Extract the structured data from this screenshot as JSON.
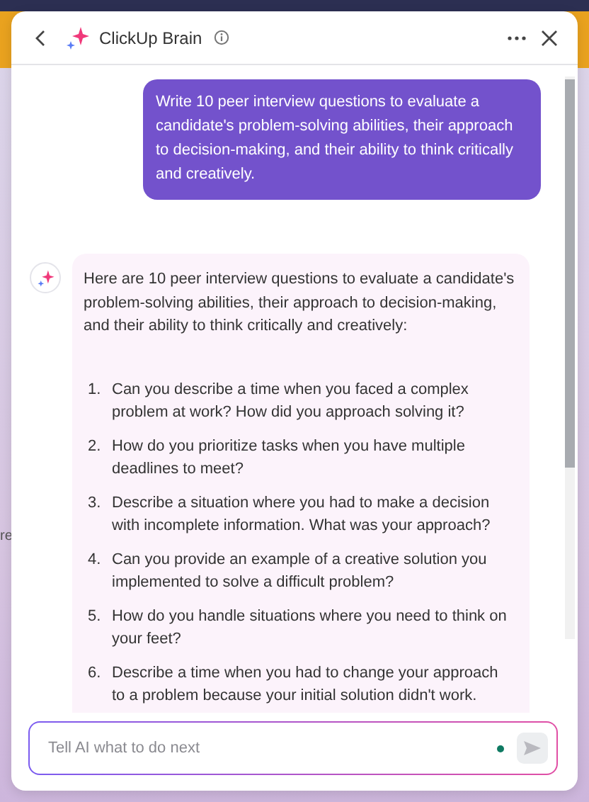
{
  "background": {
    "text": "re"
  },
  "header": {
    "title": "ClickUp Brain"
  },
  "messages": [
    {
      "kind": "user",
      "text": "Write 10 peer interview questions to evaluate a candidate's problem-solving abilities, their approach to decision-making, and their ability to think critically and creatively."
    },
    {
      "kind": "assistant",
      "intro": "Here are 10 peer interview questions to evaluate a candidate's problem-solving abilities, their approach to decision-making, and their ability to think critically and creatively:",
      "items": [
        {
          "number": "1.",
          "text": "Can you describe a time when you faced a complex problem at work? How did you approach solving it?"
        },
        {
          "number": "2.",
          "text": "How do you prioritize tasks when you have multiple deadlines to meet?"
        },
        {
          "number": "3.",
          "text": "Describe a situation where you had to make a decision with incomplete information. What was your approach?"
        },
        {
          "number": "4.",
          "text": "Can you provide an example of a creative solution you implemented to solve a difficult problem?"
        },
        {
          "number": "5.",
          "text": "How do you handle situations where you need to think on your feet?"
        },
        {
          "number": "6.",
          "text": "Describe a time when you had to change your approach to a problem because your initial solution didn't work."
        }
      ]
    }
  ],
  "composer": {
    "placeholder": "Tell AI what to do next"
  }
}
